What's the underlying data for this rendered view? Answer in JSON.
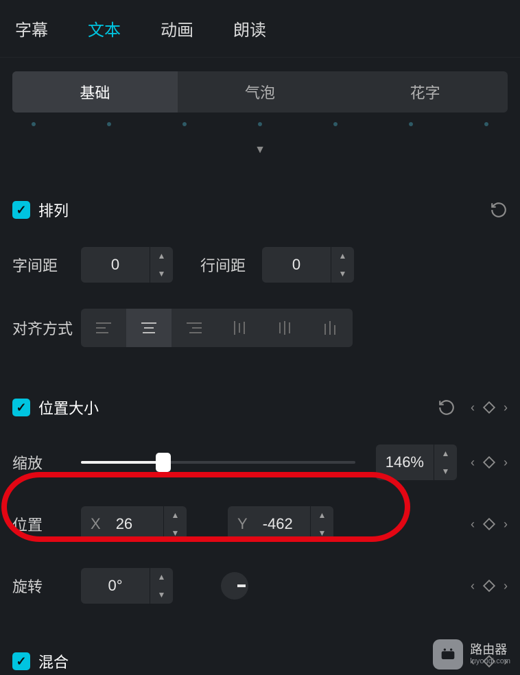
{
  "tabs": {
    "main": [
      "字幕",
      "文本",
      "动画",
      "朗读"
    ],
    "active_main": 1,
    "sub": [
      "基础",
      "气泡",
      "花字"
    ],
    "active_sub": 0
  },
  "sections": {
    "arrange": {
      "title": "排列",
      "checked": true,
      "letter_spacing_label": "字间距",
      "letter_spacing_value": "0",
      "line_spacing_label": "行间距",
      "line_spacing_value": "0",
      "align_label": "对齐方式"
    },
    "position_size": {
      "title": "位置大小",
      "checked": true,
      "scale_label": "缩放",
      "scale_value": "146%",
      "scale_ratio": 0.3,
      "position_label": "位置",
      "x_prefix": "X",
      "x_value": "26",
      "y_prefix": "Y",
      "y_value": "-462",
      "rotation_label": "旋转",
      "rotation_value": "0°"
    },
    "blend": {
      "title": "混合",
      "checked": true
    }
  },
  "watermark": {
    "title": "路由器",
    "sub": "luyouqi.com"
  }
}
